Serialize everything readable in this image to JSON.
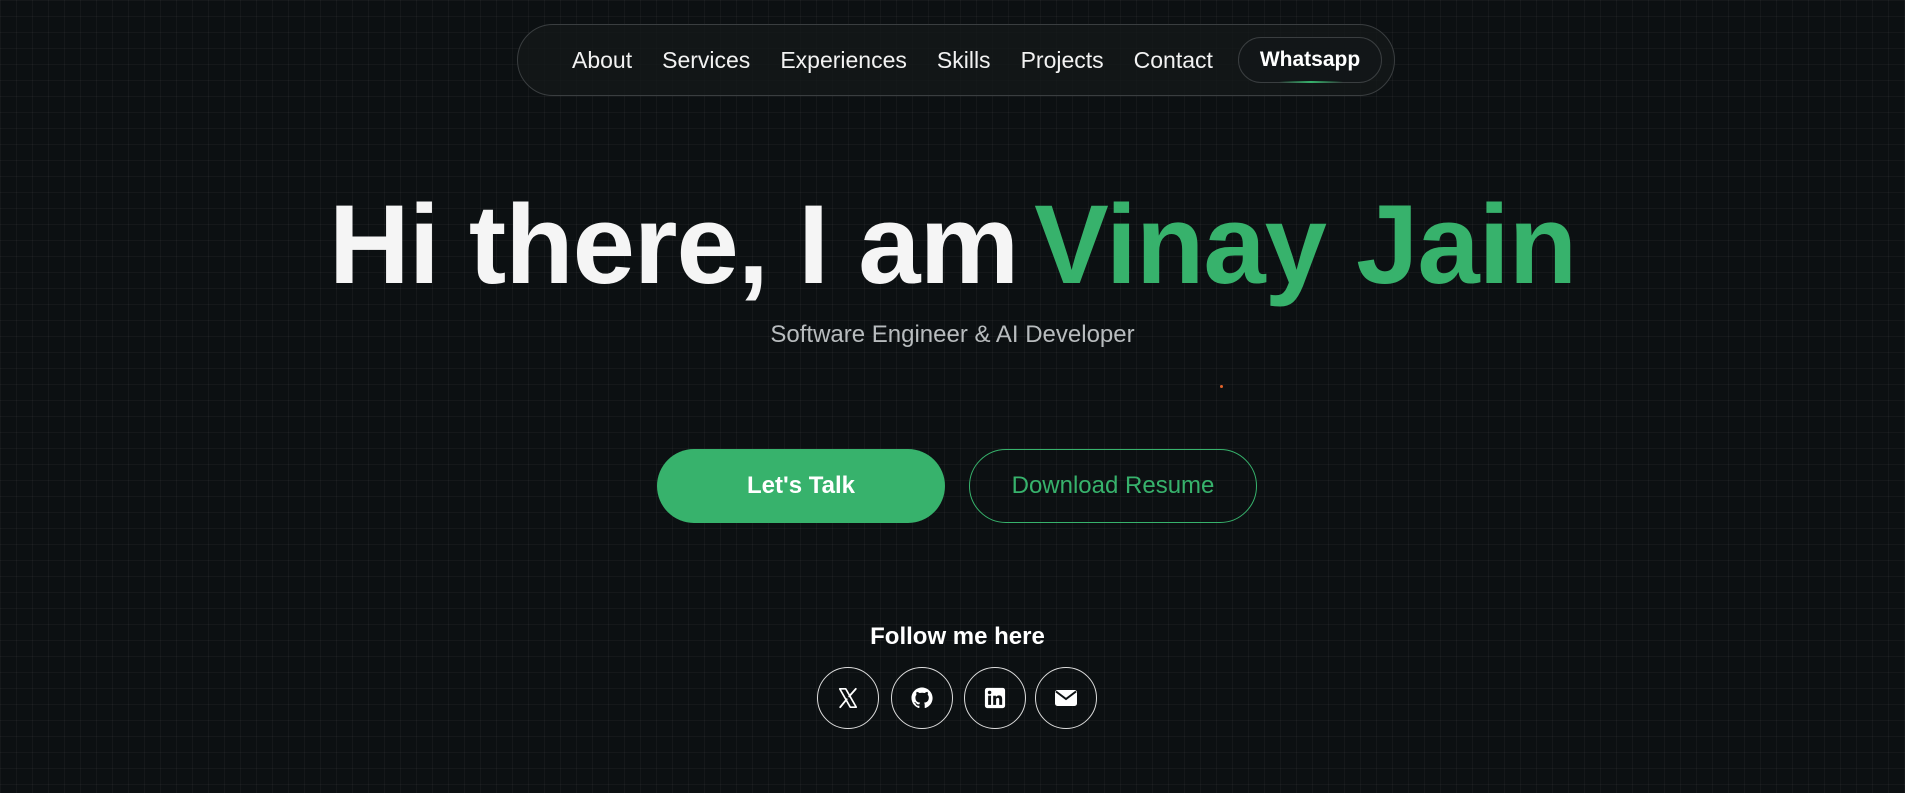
{
  "nav": {
    "links": [
      "About",
      "Services",
      "Experiences",
      "Skills",
      "Projects",
      "Contact"
    ],
    "whatsapp_label": "Whatsapp"
  },
  "hero": {
    "greeting": "Hi there, I am",
    "name": "Vinay Jain",
    "subtitle": "Software Engineer & AI Developer"
  },
  "buttons": {
    "primary_label": "Let's Talk",
    "secondary_label": "Download Resume"
  },
  "follow": {
    "label": "Follow me here",
    "icons": [
      "x-icon",
      "github-icon",
      "linkedin-icon",
      "email-icon"
    ]
  },
  "colors": {
    "background": "#0c1012",
    "accent": "#37b26c",
    "text": "#ffffff",
    "subtitle": "#b8bcbe",
    "dot": "#e3632a"
  }
}
